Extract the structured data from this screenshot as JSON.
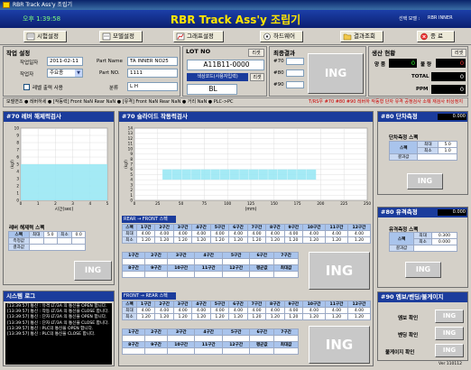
{
  "window": {
    "title": "RBR Track Ass'y 조립기"
  },
  "header": {
    "clock": "오후 1:39:58",
    "title": "RBR Track Ass'y 조립기",
    "model_label": "선택 모델 :",
    "model_value": "RBR INNER"
  },
  "toolbar": {
    "btn1": "시험설정",
    "btn2": "모델설정",
    "btn3": "그래프설정",
    "btn4": "하드웨어",
    "btn5": "결과조회",
    "btn6": "종 료"
  },
  "job": {
    "title": "작업 설정",
    "date_label": "작업일자",
    "date_value": "2011-02-11",
    "worker_label": "작업자",
    "worker_value": "주요종",
    "label_print": "레벨 출력 사용",
    "partname_label": "Part Name",
    "partname_value": "TA INNER NO25",
    "partno_label": "Part NO.",
    "partno_value": "1111",
    "class_label": "분류",
    "class_value": "L H"
  },
  "lot": {
    "title": "LOT NO",
    "apply": "리셋",
    "value": "A11B11-0000",
    "color_title": "색상코드(사용자입력)",
    "color_apply": "리셋",
    "color_value": "BL"
  },
  "final": {
    "title": "최종결과",
    "r1": "#70",
    "r2": "#80",
    "r3": "#90",
    "result": "ING"
  },
  "prod": {
    "title": "생산 현황",
    "reset": "리셋",
    "ok_label": "양 품",
    "ok_value": "0",
    "ng_label": "불 량",
    "ng_value": "0",
    "total_label": "TOTAL",
    "total_value": "0",
    "ppm_label": "PPM",
    "ppm_value": "0"
  },
  "statusbar": {
    "text": "모델변조 ● 레버하세 ● [작동력] Front NaN Rear NaN ● [유격] Front NaN Rear NaN ● 거리 NaN ● PLC->PC",
    "alert": "T/RS우 #70 #80 #90 레버하 작동형 단자 유격 공정검사 소훼 재검사 비상정지"
  },
  "s70a": {
    "title": "#70 레버 해제력검사",
    "ylabel": "(kgf)",
    "xlabel": "시간(sec)",
    "spec_title": "레버 해제력 스펙",
    "max_label": "최대",
    "max_value": "5.0",
    "min_label": "최소",
    "min_value": "0.0",
    "meas_label": "측정값",
    "result_label": "결과값",
    "result": "ING"
  },
  "chart_a": {
    "type": "area",
    "x_ticks": [
      "0",
      "1",
      "2",
      "3",
      "4",
      "5"
    ],
    "y_ticks": [
      "0",
      "1",
      "2",
      "3",
      "4",
      "5",
      "6",
      "7",
      "8",
      "9",
      "10"
    ],
    "xlim": [
      0,
      5
    ],
    "ylim": [
      0,
      10
    ],
    "band": [
      0,
      5
    ],
    "band_y": [
      0,
      5
    ]
  },
  "s70b": {
    "title": "#70 슬라이드 작동력검사",
    "ylabel": "(kgf)",
    "xlabel": "(mm)",
    "rf_label": "REAR → FRONT 스펙",
    "fr_label": "FRONT → REAR 스펙",
    "result": "ING"
  },
  "chart_b": {
    "type": "area",
    "x_ticks": [
      "0",
      "25",
      "50",
      "75",
      "100",
      "125",
      "150",
      "175",
      "200",
      "225",
      "250"
    ],
    "y_ticks": [
      "0",
      "1",
      "2",
      "3",
      "4",
      "5",
      "6",
      "7",
      "8",
      "9",
      "10",
      "11",
      "12",
      "13",
      "14"
    ],
    "xlim": [
      0,
      250
    ],
    "ylim": [
      0,
      14
    ],
    "band_x": [
      30,
      195
    ],
    "band_y": [
      4,
      6
    ]
  },
  "spec_table": {
    "head": [
      "스펙",
      "1구간",
      "2구간",
      "3구간",
      "4구간",
      "5구간",
      "6구간",
      "7구간",
      "8구간",
      "9구간",
      "10구간",
      "11구간",
      "12구간"
    ],
    "max": [
      "최대",
      "4.00",
      "4.00",
      "4.00",
      "4.00",
      "4.00",
      "4.00",
      "4.00",
      "4.00",
      "4.00",
      "4.00",
      "4.00",
      "4.00"
    ],
    "min": [
      "최소",
      "1.20",
      "1.20",
      "1.20",
      "1.20",
      "1.20",
      "1.20",
      "1.20",
      "1.20",
      "1.20",
      "1.20",
      "1.20",
      "1.20"
    ]
  },
  "meas_table": {
    "head1": [
      "1구간",
      "2구간",
      "3구간",
      "4구간",
      "5구간",
      "6구간",
      "7구간"
    ],
    "head2": [
      "8구간",
      "9구간",
      "10구간",
      "11구간",
      "12구간",
      "평균값",
      "최대값"
    ]
  },
  "log": {
    "title": "시스템 로그",
    "lines": [
      "[13:39:57] 통신 : 유격 LT/3A 의 통신을 OPEN 합니다.",
      "[13:39:57] 통신 : 작동 LT/3A 의 통신을 CLOSE 합니다.",
      "[13:39:57] 통신 : 단자 LT/3A 의 통신을 OPEN 합니다.",
      "[13:39:57] 통신 : 단자 LT/3A 의 통신을 CLOSE 합니다.",
      "[13:39:57] 통신 : PLC의 통신을 OPEN 합니다.",
      "[13:39:57] 통신 : PLC의 통신을 CLOSE 합니다."
    ]
  },
  "s80a": {
    "title": "#80 단차측정",
    "value": "0.000",
    "spec_title": "단차측정 스펙",
    "max_label": "최대",
    "max_value": "5.0",
    "min_label": "최소",
    "min_value": "1.0",
    "result_label": "결과값",
    "spec_col": "스펙",
    "result": "ING"
  },
  "s80b": {
    "title": "#80 유격측정",
    "value": "0.000",
    "spec_title": "유격측정 스펙",
    "max_label": "최대",
    "max_value": "0.300",
    "min_label": "최소",
    "min_value": "0.000",
    "result_label": "결과값",
    "spec_col": "스펙",
    "result": "ING"
  },
  "s90": {
    "title": "#90 엠보/벤딩/불게이지",
    "embo": "엠보 확인",
    "bend": "벤딩 확인",
    "gauge": "불게이지 확인",
    "r1": "ING",
    "r2": "ING",
    "r3": "ING"
  },
  "version": "Ver 110112",
  "colors": {
    "header_blue": "#1b3c9c",
    "title_yellow": "#ffe600",
    "band_cyan": "#9ae8f4"
  }
}
